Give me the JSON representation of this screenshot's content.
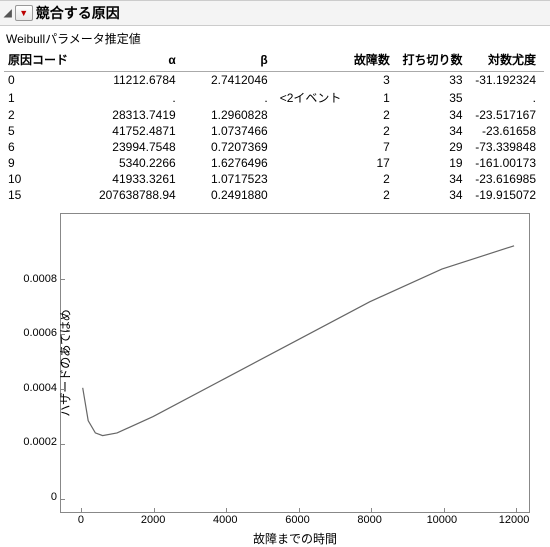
{
  "header": {
    "title": "競合する原因"
  },
  "subtitle": "Weibullパラメータ推定値",
  "table": {
    "columns": [
      "原因コード",
      "α",
      "β",
      "",
      "故障数",
      "打ち切り数",
      "対数尤度"
    ],
    "rows": [
      {
        "code": "0",
        "alpha": "11212.6784",
        "beta": "2.7412046",
        "note": "",
        "fail": "3",
        "cens": "33",
        "ll": "-31.192324"
      },
      {
        "code": "1",
        "alpha": ".",
        "beta": ".",
        "note": "<2イベント",
        "fail": "1",
        "cens": "35",
        "ll": "."
      },
      {
        "code": "2",
        "alpha": "28313.7419",
        "beta": "1.2960828",
        "note": "",
        "fail": "2",
        "cens": "34",
        "ll": "-23.517167"
      },
      {
        "code": "5",
        "alpha": "41752.4871",
        "beta": "1.0737466",
        "note": "",
        "fail": "2",
        "cens": "34",
        "ll": "-23.61658"
      },
      {
        "code": "6",
        "alpha": "23994.7548",
        "beta": "0.7207369",
        "note": "",
        "fail": "7",
        "cens": "29",
        "ll": "-73.339848"
      },
      {
        "code": "9",
        "alpha": "5340.2266",
        "beta": "1.6276496",
        "note": "",
        "fail": "17",
        "cens": "19",
        "ll": "-161.00173"
      },
      {
        "code": "10",
        "alpha": "41933.3261",
        "beta": "1.0717523",
        "note": "",
        "fail": "2",
        "cens": "34",
        "ll": "-23.616985"
      },
      {
        "code": "15",
        "alpha": "207638788.94",
        "beta": "0.2491880",
        "note": "",
        "fail": "2",
        "cens": "34",
        "ll": "-19.915072"
      }
    ]
  },
  "chart_data": {
    "type": "line",
    "title": "",
    "xlabel": "故障までの時間",
    "ylabel": "ハザードのあてはめ",
    "xlim": [
      0,
      12000
    ],
    "ylim": [
      0,
      0.001
    ],
    "xticks": [
      0,
      2000,
      4000,
      6000,
      8000,
      10000,
      12000
    ],
    "yticks": [
      0,
      0.0002,
      0.0004,
      0.0006,
      0.0008
    ],
    "series": [
      {
        "name": "hazard",
        "x": [
          50,
          200,
          400,
          600,
          1000,
          2000,
          4000,
          6000,
          8000,
          10000,
          12000
        ],
        "y": [
          0.0004,
          0.00028,
          0.000235,
          0.000225,
          0.000235,
          0.000295,
          0.000435,
          0.000575,
          0.000715,
          0.000835,
          0.00092
        ]
      }
    ]
  }
}
